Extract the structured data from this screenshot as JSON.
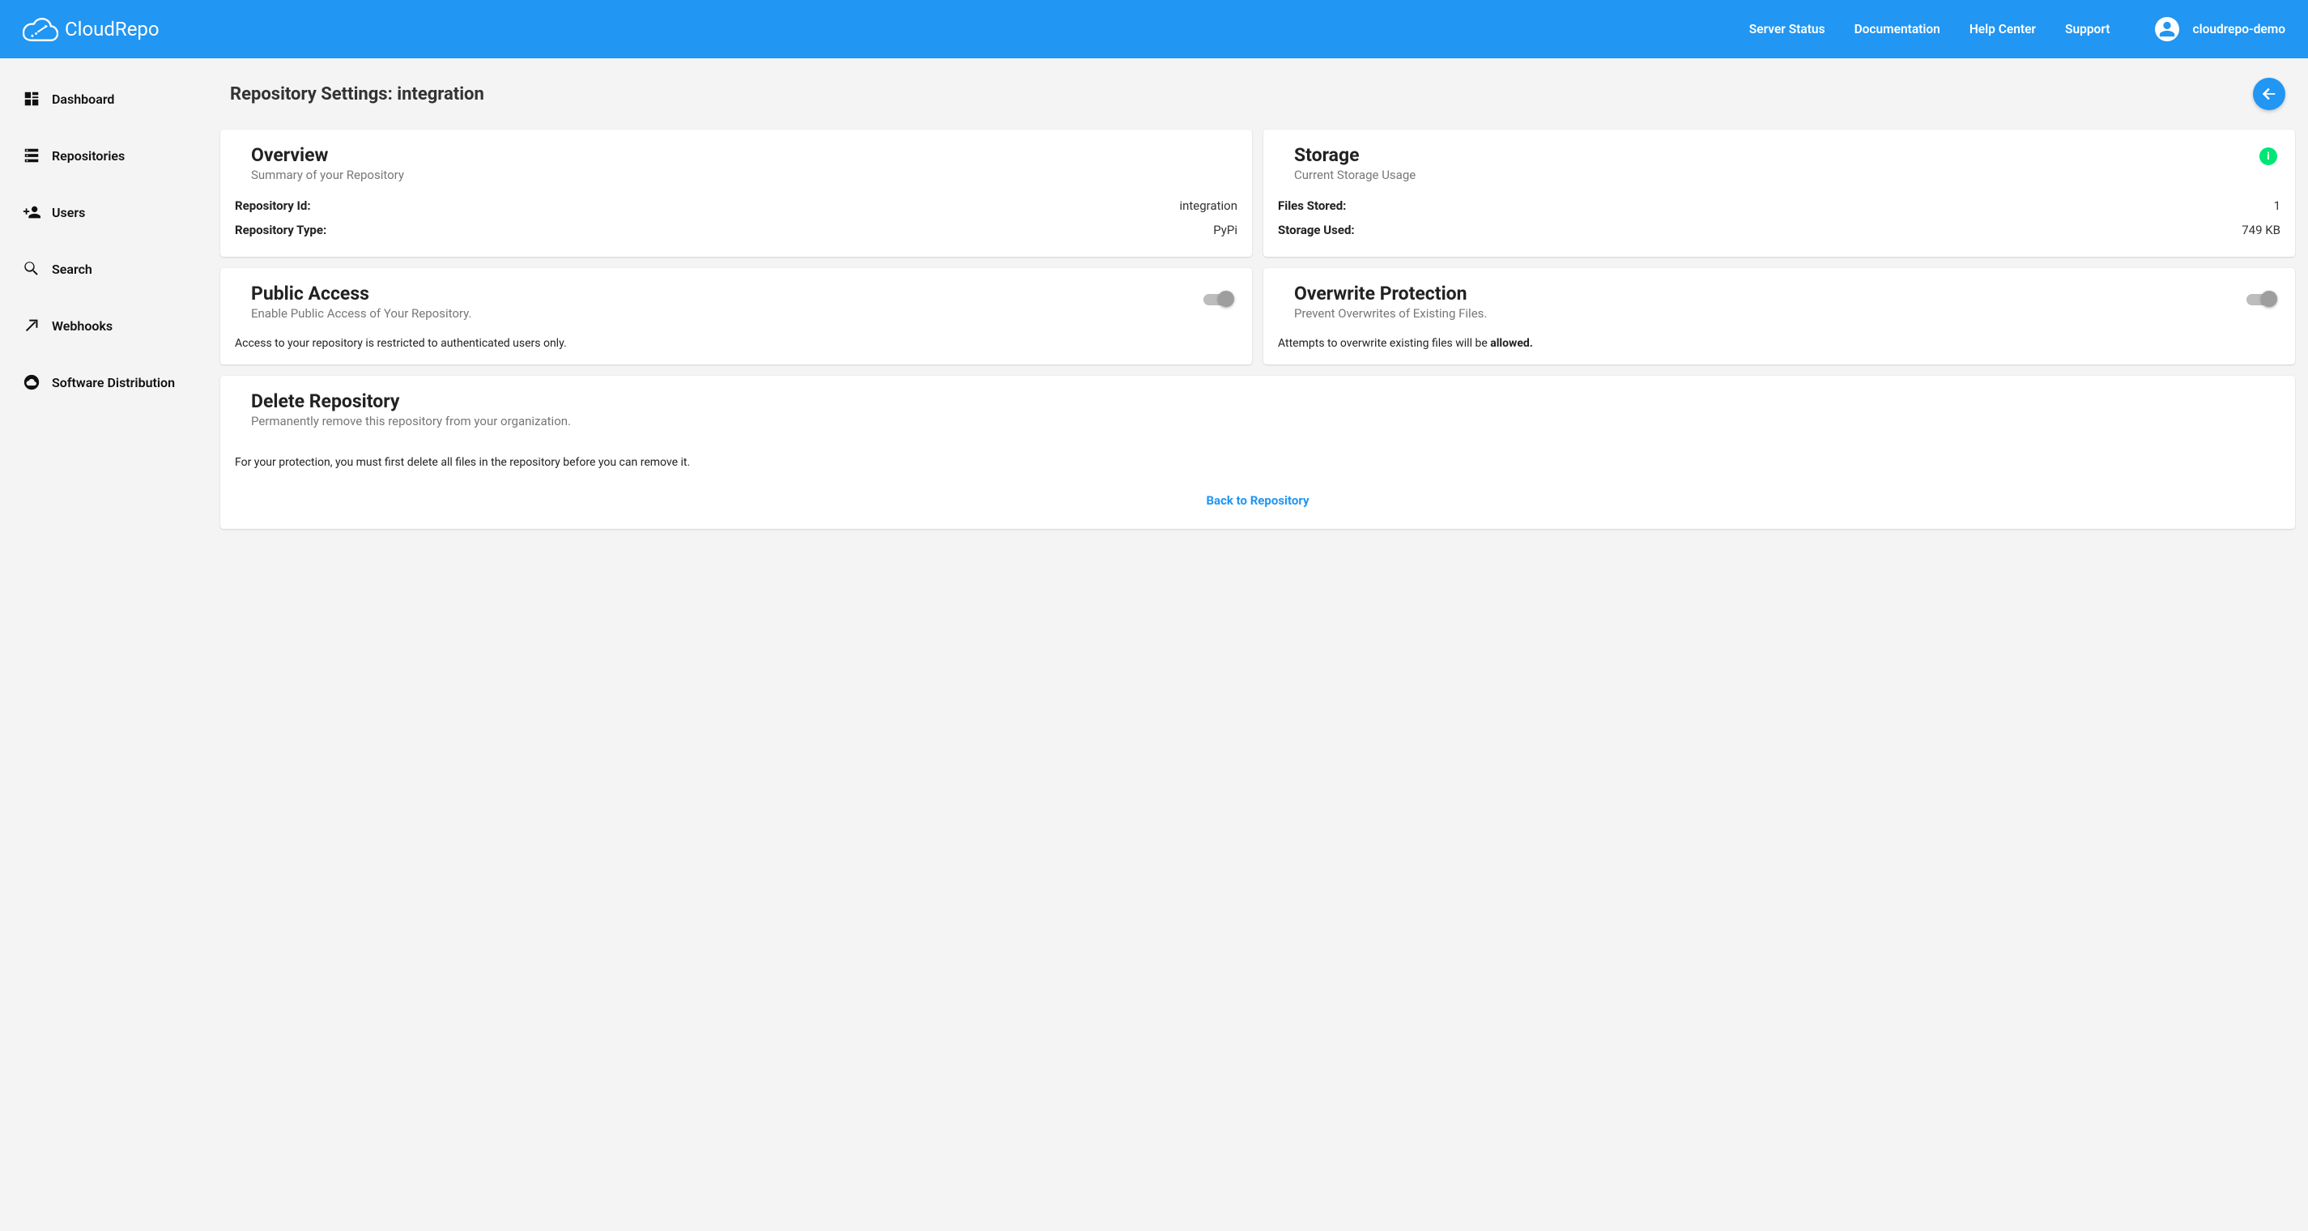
{
  "brand": "CloudRepo",
  "header": {
    "links": [
      "Server Status",
      "Documentation",
      "Help Center",
      "Support"
    ],
    "username": "cloudrepo-demo"
  },
  "sidebar": {
    "items": [
      {
        "label": "Dashboard"
      },
      {
        "label": "Repositories"
      },
      {
        "label": "Users"
      },
      {
        "label": "Search"
      },
      {
        "label": "Webhooks"
      },
      {
        "label": "Software Distribution"
      }
    ]
  },
  "page": {
    "title": "Repository Settings: integration"
  },
  "overview": {
    "title": "Overview",
    "subtitle": "Summary of your Repository",
    "repo_id_label": "Repository Id:",
    "repo_id_value": "integration",
    "repo_type_label": "Repository Type:",
    "repo_type_value": "PyPi"
  },
  "storage": {
    "title": "Storage",
    "subtitle": "Current Storage Usage",
    "files_label": "Files Stored:",
    "files_value": "1",
    "used_label": "Storage Used:",
    "used_value": "749 KB"
  },
  "public_access": {
    "title": "Public Access",
    "subtitle": "Enable Public Access of Your Repository.",
    "body": "Access to your repository is restricted to authenticated users only."
  },
  "overwrite": {
    "title": "Overwrite Protection",
    "subtitle": "Prevent Overwrites of Existing Files.",
    "body_prefix": "Attempts to overwrite existing files will be ",
    "body_bold": "allowed."
  },
  "delete": {
    "title": "Delete Repository",
    "subtitle": "Permanently remove this repository from your organization.",
    "body": "For your protection, you must first delete all files in the repository before you can remove it.",
    "link": "Back to Repository"
  }
}
